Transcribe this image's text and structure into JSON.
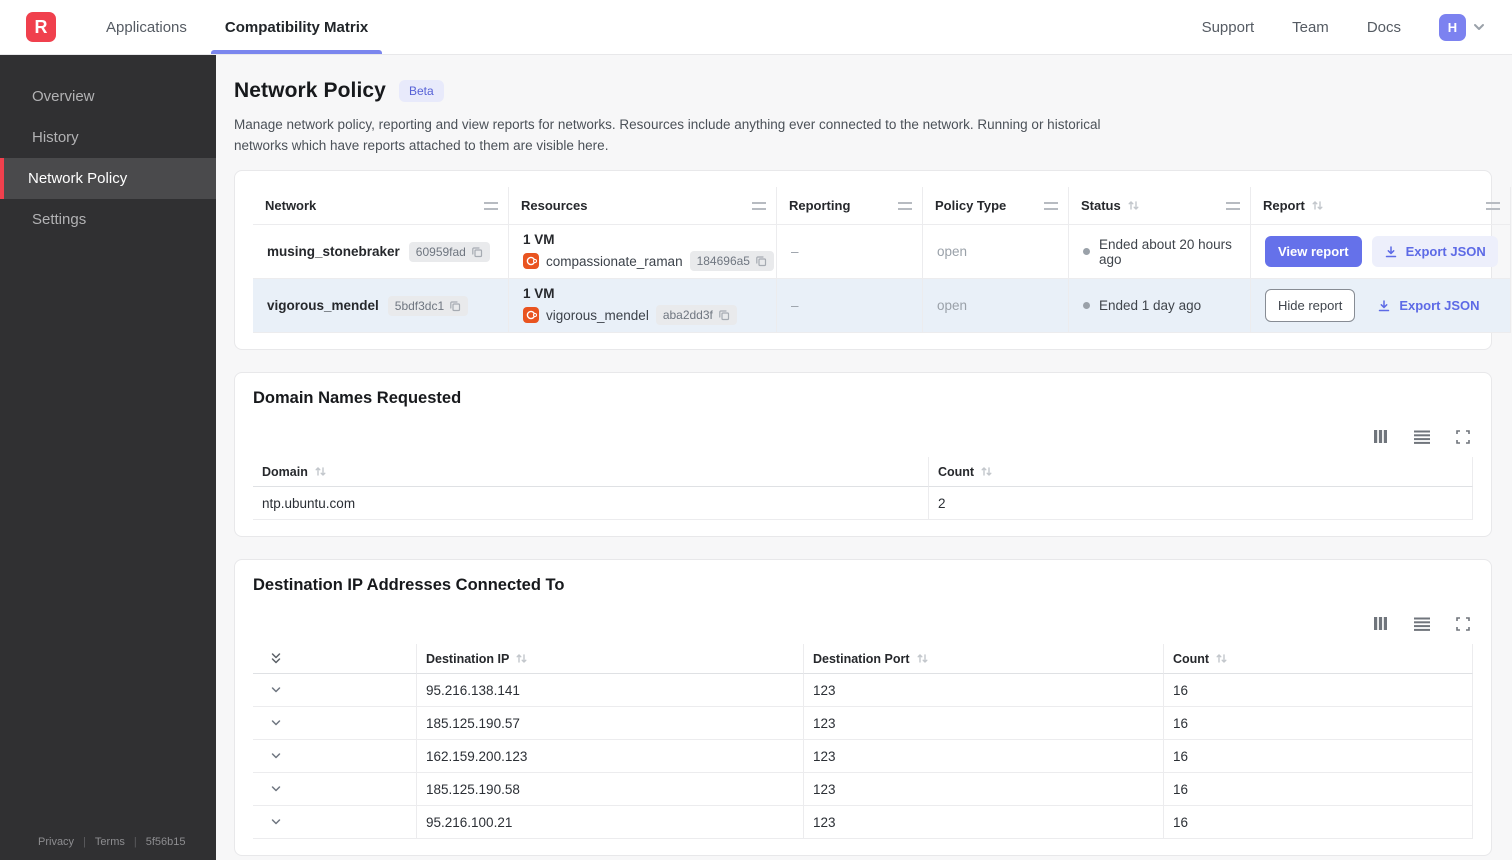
{
  "topbar": {
    "logo": "R",
    "nav": [
      {
        "label": "Applications",
        "active": false
      },
      {
        "label": "Compatibility Matrix",
        "active": true
      }
    ],
    "links": [
      "Support",
      "Team",
      "Docs"
    ],
    "avatar_initial": "H"
  },
  "sidebar": {
    "items": [
      {
        "label": "Overview",
        "active": false
      },
      {
        "label": "History",
        "active": false
      },
      {
        "label": "Network Policy",
        "active": true
      },
      {
        "label": "Settings",
        "active": false
      }
    ],
    "footer": {
      "privacy": "Privacy",
      "terms": "Terms",
      "version": "5f56b15"
    }
  },
  "page": {
    "title": "Network Policy",
    "beta_badge": "Beta",
    "description": "Manage network policy, reporting and view reports for networks. Resources include anything ever connected to the network. Running or historical networks which have reports attached to them are visible here."
  },
  "network_table": {
    "columns": [
      "Network",
      "Resources",
      "Reporting",
      "Policy Type",
      "Status",
      "Report"
    ],
    "rows": [
      {
        "network": "musing_stonebraker",
        "network_id": "60959fad",
        "resources_count": "1 VM",
        "resource_name": "compassionate_raman",
        "resource_id": "184696a5",
        "reporting": "–",
        "policy_type": "open",
        "status": "Ended about 20 hours ago",
        "report_button": "View report",
        "export_button": "Export JSON",
        "highlighted": false
      },
      {
        "network": "vigorous_mendel",
        "network_id": "5bdf3dc1",
        "resources_count": "1 VM",
        "resource_name": "vigorous_mendel",
        "resource_id": "aba2dd3f",
        "reporting": "–",
        "policy_type": "open",
        "status": "Ended 1 day ago",
        "report_button": "Hide report",
        "export_button": "Export JSON",
        "highlighted": true
      }
    ]
  },
  "domain_card": {
    "title": "Domain Names Requested",
    "columns": [
      "Domain",
      "Count"
    ],
    "rows": [
      {
        "domain": "ntp.ubuntu.com",
        "count": "2"
      }
    ]
  },
  "ip_card": {
    "title": "Destination IP Addresses Connected To",
    "columns": [
      "Destination IP",
      "Destination Port",
      "Count"
    ],
    "rows": [
      {
        "ip": "95.216.138.141",
        "port": "123",
        "count": "16"
      },
      {
        "ip": "185.125.190.57",
        "port": "123",
        "count": "16"
      },
      {
        "ip": "162.159.200.123",
        "port": "123",
        "count": "16"
      },
      {
        "ip": "185.125.190.58",
        "port": "123",
        "count": "16"
      },
      {
        "ip": "95.216.100.21",
        "port": "123",
        "count": "16"
      }
    ]
  },
  "icons": {
    "ubuntu-icon": "orange circle-of-friends VM provider glyph",
    "copy-icon": "two overlapping squares",
    "download-icon": "arrow down into tray",
    "sort-icon": "up/down arrow pair",
    "drag-handle-icon": "double horizontal bars",
    "columns-icon": "three vertical bars",
    "rows-icon": "four horizontal lines",
    "expand-icon": "four corners fullscreen",
    "chevron-down-icon": "single chevron down",
    "double-chevron-icon": "double chevron down"
  },
  "colors": {
    "brand_red": "#f0404d",
    "accent_indigo": "#6571ea",
    "accent_underline": "#7b86ee",
    "beta_bg": "#e8eafb",
    "row_highlight": "#e9f0f8",
    "sidebar_bg": "#303032",
    "sidebar_active_bg": "#4a4a4c",
    "ubuntu_orange": "#e95420",
    "status_dot": "#9aa1a9"
  }
}
